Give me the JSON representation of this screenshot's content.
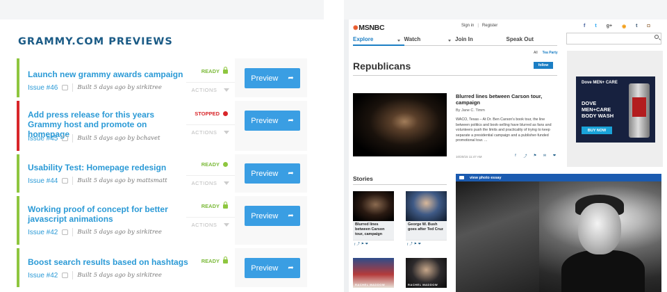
{
  "left": {
    "title": "GRAMMY.COM PREVIEWS",
    "builds": [
      {
        "title": "Launch new grammy awards campaign",
        "issue": "Issue #46",
        "built": "Built 5 days ago by sirkitree",
        "status": "READY",
        "status_icon": "lock-icon",
        "actions": "ACTIONS",
        "button": "Preview"
      },
      {
        "title": "Add press release for this years Grammy host and promote on homepage",
        "issue": "Issue #45",
        "built": "Built 5 days ago by bchavet",
        "status": "STOPPED",
        "status_icon": "stopped-dot-icon",
        "actions": "ACTIONS",
        "button": "Preview"
      },
      {
        "title": "Usability Test: Homepage redesign",
        "issue": "Issue #44",
        "built": "Built 5 days ago by mattsmatt",
        "status": "READY",
        "status_icon": "ready-dot-icon",
        "actions": "ACTIONS",
        "button": "Preview"
      },
      {
        "title": "Working proof of concept for better javascript animations",
        "issue": "Issue #42",
        "built": "Built 5 days ago by sirkitree",
        "status": "READY",
        "status_icon": "lock-icon",
        "actions": "ACTIONS",
        "button": "Preview"
      },
      {
        "title": "Boost search results based on hashtags",
        "issue": "Issue #42",
        "built": "Built 5 days ago by sirkitree",
        "status": "READY",
        "status_icon": "lock-icon",
        "actions": "ACTIONS",
        "button": "Preview"
      }
    ],
    "colors": {
      "ready": "#8ec63f",
      "stopped": "#d8262a",
      "button": "#3a9ee3",
      "title": "#1b5b86"
    }
  },
  "right": {
    "logo": "MSNBC",
    "auth": {
      "sign_in": "Sign in",
      "register": "Register"
    },
    "social": [
      {
        "icon": "facebook-icon",
        "glyph": "f",
        "color": "#3b5998"
      },
      {
        "icon": "twitter-icon",
        "glyph": "t",
        "color": "#1da1f2"
      },
      {
        "icon": "google-plus-icon",
        "glyph": "g+",
        "color": "#555555"
      },
      {
        "icon": "rss-icon",
        "glyph": "◉",
        "color": "#f39c12"
      },
      {
        "icon": "tumblr-icon",
        "glyph": "t",
        "color": "#34526f"
      },
      {
        "icon": "instagram-icon",
        "glyph": "◘",
        "color": "#8a5a2a"
      }
    ],
    "nav": [
      "Explore",
      "Watch",
      "Join In",
      "Speak Out"
    ],
    "crumb": {
      "all": "All",
      "current": "Tea Party"
    },
    "section_title": "Republicans",
    "follow": "follow",
    "ad": {
      "brand": "Dove MEN+ CARE",
      "copy": "DOVE MEN+CARE BODY WASH",
      "button": "BUY NOW"
    },
    "feature": {
      "title": "Blurred lines between Carson tour, campaign",
      "byline": "By Jane C. Timm",
      "summary": "WACO, Texas – At Dr. Ben Carson's book tour, the line between politics and book-selling have blurred as fans and volunteers push the limits and practicality of trying to keep separate a presidential campaign and a publisher-funded promotional tour. ...",
      "date": "10/20/15 11:47 AM",
      "share": [
        "f",
        "⤴",
        "⚑",
        "✉",
        "❤"
      ]
    },
    "stories_title": "Stories",
    "stories": [
      {
        "caption": "Blurred lines between Carson tour, campaign"
      },
      {
        "caption": "George W. Bush goes after Ted Cruz"
      },
      {
        "caption": "RACHEL MADDOW"
      },
      {
        "caption": "RACHEL MADDOW"
      }
    ],
    "photo_essay": "view photo essay"
  }
}
